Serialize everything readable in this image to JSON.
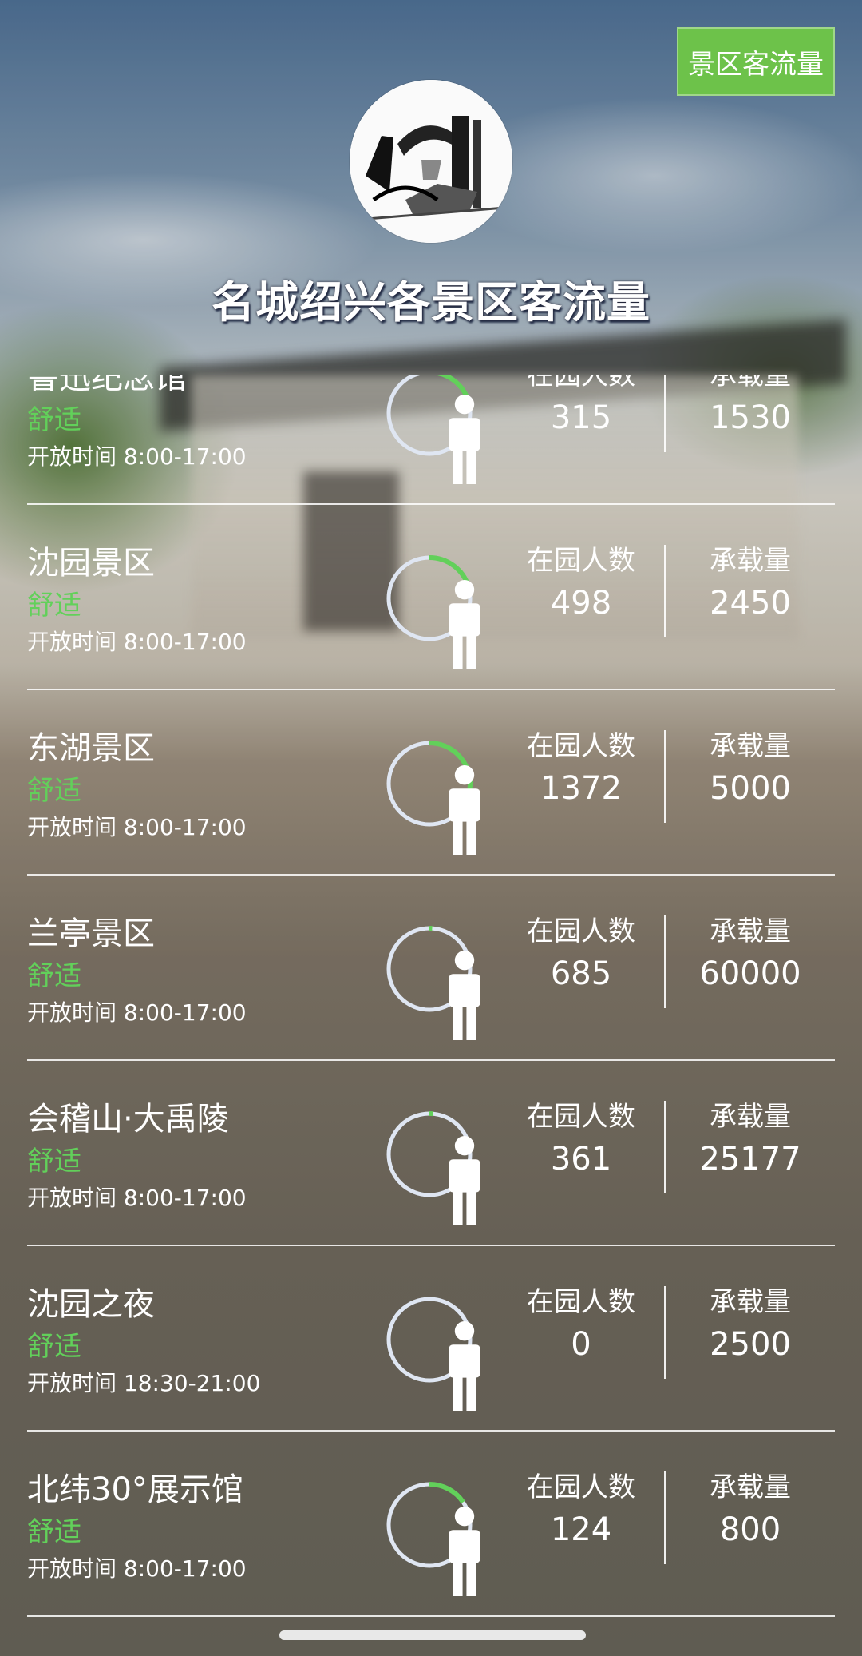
{
  "header": {
    "title": "名城绍兴各景区客流量",
    "top_button_label": "景区客流量"
  },
  "colors": {
    "accent": "#6dc24a",
    "status_green": "#62d05a",
    "ring_track": "#dfe6f2",
    "ring_progress": "#62d05a"
  },
  "labels": {
    "in_park": "在园人数",
    "capacity": "承载量"
  },
  "spots": [
    {
      "name": "鲁迅纪念馆",
      "status": "舒适",
      "hours": "开放时间 8:00-17:00",
      "visitors": "315",
      "capacity": "1530",
      "load_ratio": 0.206
    },
    {
      "name": "沈园景区",
      "status": "舒适",
      "hours": "开放时间 8:00-17:00",
      "visitors": "498",
      "capacity": "2450",
      "load_ratio": 0.203
    },
    {
      "name": "东湖景区",
      "status": "舒适",
      "hours": "开放时间 8:00-17:00",
      "visitors": "1372",
      "capacity": "5000",
      "load_ratio": 0.274
    },
    {
      "name": "兰亭景区",
      "status": "舒适",
      "hours": "开放时间 8:00-17:00",
      "visitors": "685",
      "capacity": "60000",
      "load_ratio": 0.011
    },
    {
      "name": "会稽山·大禹陵",
      "status": "舒适",
      "hours": "开放时间 8:00-17:00",
      "visitors": "361",
      "capacity": "25177",
      "load_ratio": 0.014
    },
    {
      "name": "沈园之夜",
      "status": "舒适",
      "hours": "开放时间 18:30-21:00",
      "visitors": "0",
      "capacity": "2500",
      "load_ratio": 0
    },
    {
      "name": "北纬30°展示馆",
      "status": "舒适",
      "hours": "开放时间 8:00-17:00",
      "visitors": "124",
      "capacity": "800",
      "load_ratio": 0.155
    }
  ]
}
